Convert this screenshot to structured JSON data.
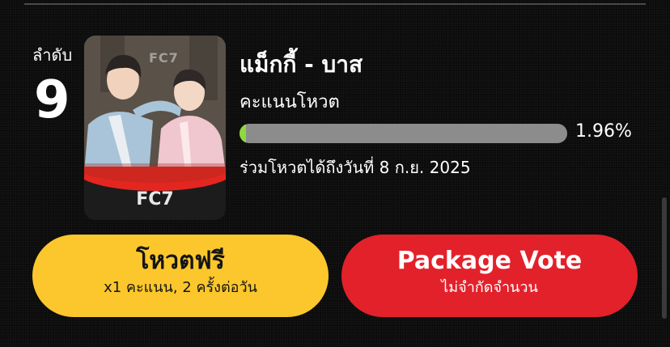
{
  "entry": {
    "rank_label": "ลำดับ",
    "rank": "9",
    "name": "แม็กกี้ - บาส",
    "score_label": "คะแนนโหวต",
    "percent": 1.96,
    "percent_text": "1.96%",
    "vote_until": "ร่วมโหวตได้ถึงวันที่ 8 ก.ย. 2025",
    "thumbnail": {
      "caption": "FC7",
      "watermark": "FC7"
    }
  },
  "buttons": {
    "free_vote": {
      "title": "โหวตฟรี",
      "subtitle": "x1 คะแนน, 2 ครั้งต่อวัน"
    },
    "package_vote": {
      "title": "Package Vote",
      "subtitle": "ไม่จำกัดจำนวน"
    }
  },
  "colors": {
    "background": "#0b0b0b",
    "progress_fill": "#8fd840",
    "progress_track": "#8c8c8c",
    "free_button": "#fcc72c",
    "package_button": "#e3212b",
    "thumb_accent": "#e42620"
  }
}
